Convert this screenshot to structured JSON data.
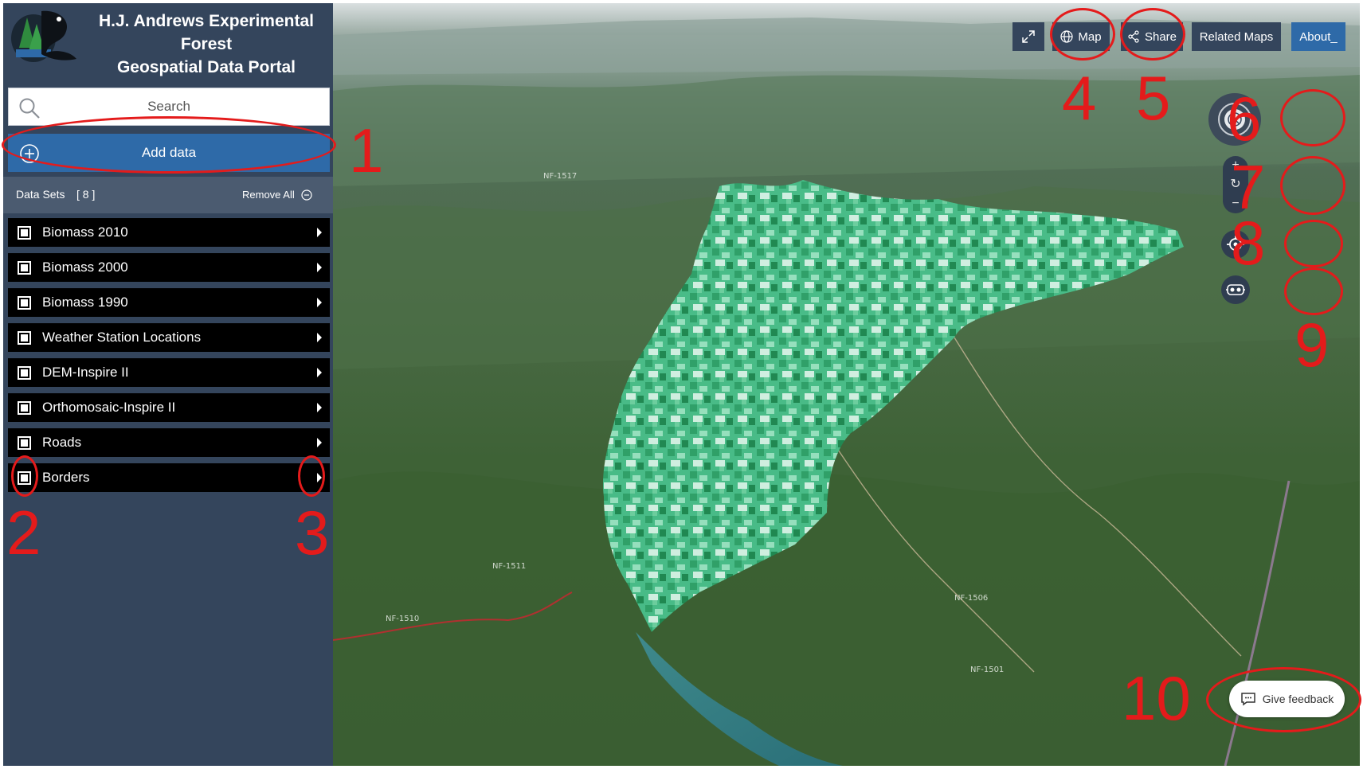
{
  "header": {
    "title_line1": "H.J. Andrews Experimental Forest",
    "title_line2": "Geospatial Data Portal"
  },
  "search": {
    "placeholder": "Search",
    "icon": "search-icon"
  },
  "add_data": {
    "label": "Add data",
    "icon": "plus-circle-icon"
  },
  "datasets": {
    "label": "Data Sets",
    "count": "[ 8 ]",
    "remove_all": "Remove All",
    "layers": [
      {
        "name": "Biomass 2010"
      },
      {
        "name": "Biomass 2000"
      },
      {
        "name": "Biomass 1990"
      },
      {
        "name": "Weather Station Locations"
      },
      {
        "name": "DEM-Inspire II"
      },
      {
        "name": "Orthomosaic-Inspire II"
      },
      {
        "name": "Roads"
      },
      {
        "name": "Borders"
      }
    ]
  },
  "toolbar": {
    "fullscreen_icon": "expand-icon",
    "map": "Map",
    "share": "Share",
    "related_maps": "Related Maps",
    "about": "About_"
  },
  "map_controls": {
    "compass_icon": "compass-icon",
    "zoom_in": "+",
    "reset": "↻",
    "zoom_out": "−",
    "locate_icon": "crosshair-icon",
    "vr_icon": "vr-headset-icon"
  },
  "feedback": {
    "label": "Give feedback",
    "icon": "chat-icon"
  },
  "map_labels": [
    "NF-1517",
    "NF-1510",
    "NF-1501",
    "NF-1506",
    "NF-1511"
  ],
  "annotations": [
    "1",
    "2",
    "3",
    "4",
    "5",
    "6",
    "7",
    "8",
    "9",
    "10"
  ],
  "colors": {
    "sidebar": "#34455c",
    "accent": "#2e6aa8",
    "annotation": "#e41b1b",
    "biomass_layer": "#3fbf85"
  }
}
